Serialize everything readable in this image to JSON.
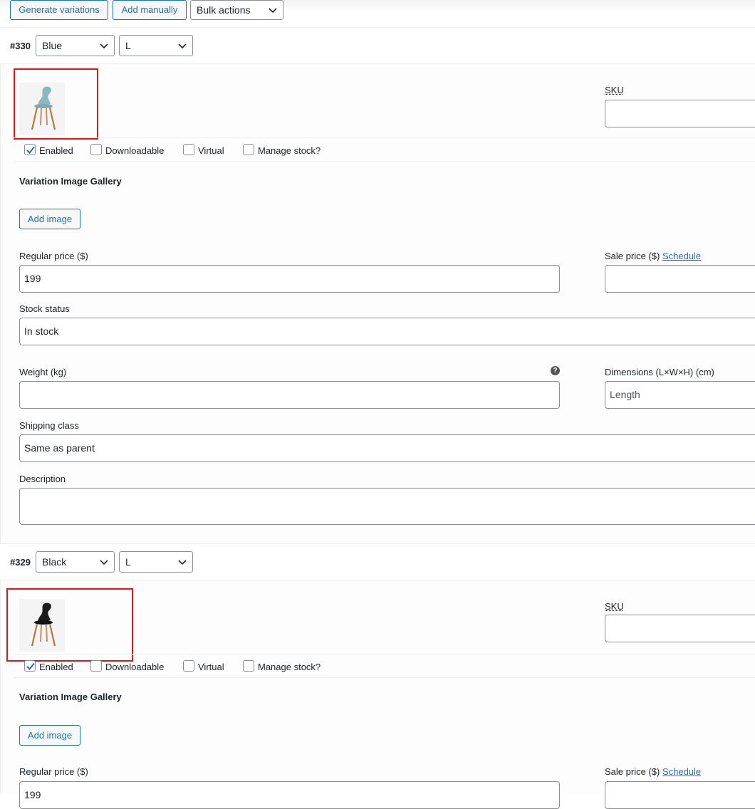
{
  "toolbar": {
    "generate_label": "Generate variations",
    "add_manually_label": "Add manually",
    "bulk_actions_label": "Bulk actions"
  },
  "variations": [
    {
      "id": "#330",
      "color": "Blue",
      "size": "L",
      "image_icon": "chair-blue-icon",
      "sku_label": "SKU",
      "enabled_label": "Enabled",
      "downloadable_label": "Downloadable",
      "virtual_label": "Virtual",
      "manage_stock_label": "Manage stock?",
      "gallery_title": "Variation Image Gallery",
      "add_image_label": "Add image",
      "regular_price_label": "Regular price ($)",
      "regular_price_value": "199",
      "sale_price_label": "Sale price ($)",
      "schedule_label": "Schedule",
      "stock_status_label": "Stock status",
      "stock_status_value": "In stock",
      "weight_label": "Weight (kg)",
      "dimensions_label": "Dimensions (L×W×H) (cm)",
      "length_placeholder": "Length",
      "shipping_class_label": "Shipping class",
      "shipping_class_value": "Same as parent",
      "description_label": "Description",
      "enabled": true,
      "downloadable": false,
      "virtual": false,
      "manage_stock": false
    },
    {
      "id": "#329",
      "color": "Black",
      "size": "L",
      "image_icon": "chair-black-icon",
      "sku_label": "SKU",
      "enabled_label": "Enabled",
      "downloadable_label": "Downloadable",
      "virtual_label": "Virtual",
      "manage_stock_label": "Manage stock?",
      "gallery_title": "Variation Image Gallery",
      "add_image_label": "Add image",
      "regular_price_label": "Regular price ($)",
      "regular_price_value": "199",
      "sale_price_label": "Sale price ($)",
      "schedule_label": "Schedule",
      "enabled": true,
      "downloadable": false,
      "virtual": false,
      "manage_stock": false
    }
  ],
  "colors": {
    "accent": "#2271b1",
    "highlight_box": "#e3121b",
    "border": "#8c8f94"
  }
}
